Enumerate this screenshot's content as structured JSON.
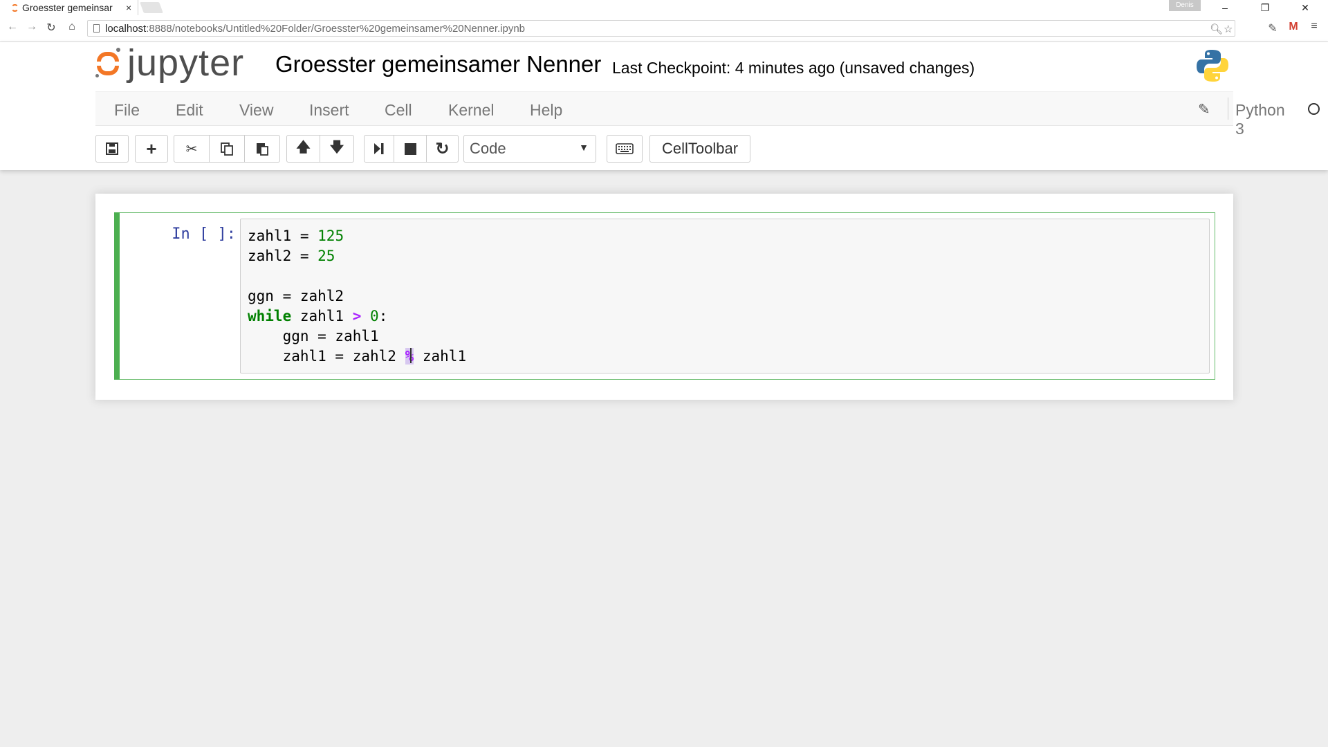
{
  "browser": {
    "tab_title": "Groesster gemeinsar",
    "tab_close": "×",
    "profile_name": "Denis",
    "url_host": "localhost",
    "url_path": ":8888/notebooks/Untitled%20Folder/Groesster%20gemeinsamer%20Nenner.ipynb",
    "icons": [
      "back-arrow-icon",
      "forward-arrow-icon",
      "reload-icon",
      "home-icon",
      "zoom-icon",
      "star-icon",
      "extension-icon",
      "gmail-icon",
      "menu-icon"
    ]
  },
  "header": {
    "logo_text": "jupyter",
    "notebook_name": "Groesster gemeinsamer Nenner",
    "checkpoint": "Last Checkpoint: 4 minutes ago (unsaved changes)"
  },
  "menu": {
    "items": [
      "File",
      "Edit",
      "View",
      "Insert",
      "Cell",
      "Kernel",
      "Help"
    ],
    "kernel_name": "Python 3"
  },
  "toolbar": {
    "cell_type": "Code",
    "celltoolbar_label": "CellToolbar"
  },
  "cell": {
    "prompt": "In [ ]:",
    "code": {
      "l1_var": "zahl1 = ",
      "l1_num": "125",
      "l2_var": "zahl2 = ",
      "l2_num": "25",
      "l4": "ggn = zahl2",
      "l5_kw": "while",
      "l5_a": " zahl1 ",
      "l5_op": ">",
      "l5_b": " ",
      "l5_num": "0",
      "l5_c": ":",
      "l6": "    ggn = zahl1",
      "l7_a": "    zahl1 = zahl2 ",
      "l7_op": "%",
      "l7_b": " zahl1"
    }
  },
  "colors": {
    "jupyter_orange": "#f37726",
    "cell_edit_green": "#66bb6a",
    "prompt_blue": "#303f9f",
    "keyword_green": "#008000",
    "operator_purple": "#aa22ff"
  }
}
